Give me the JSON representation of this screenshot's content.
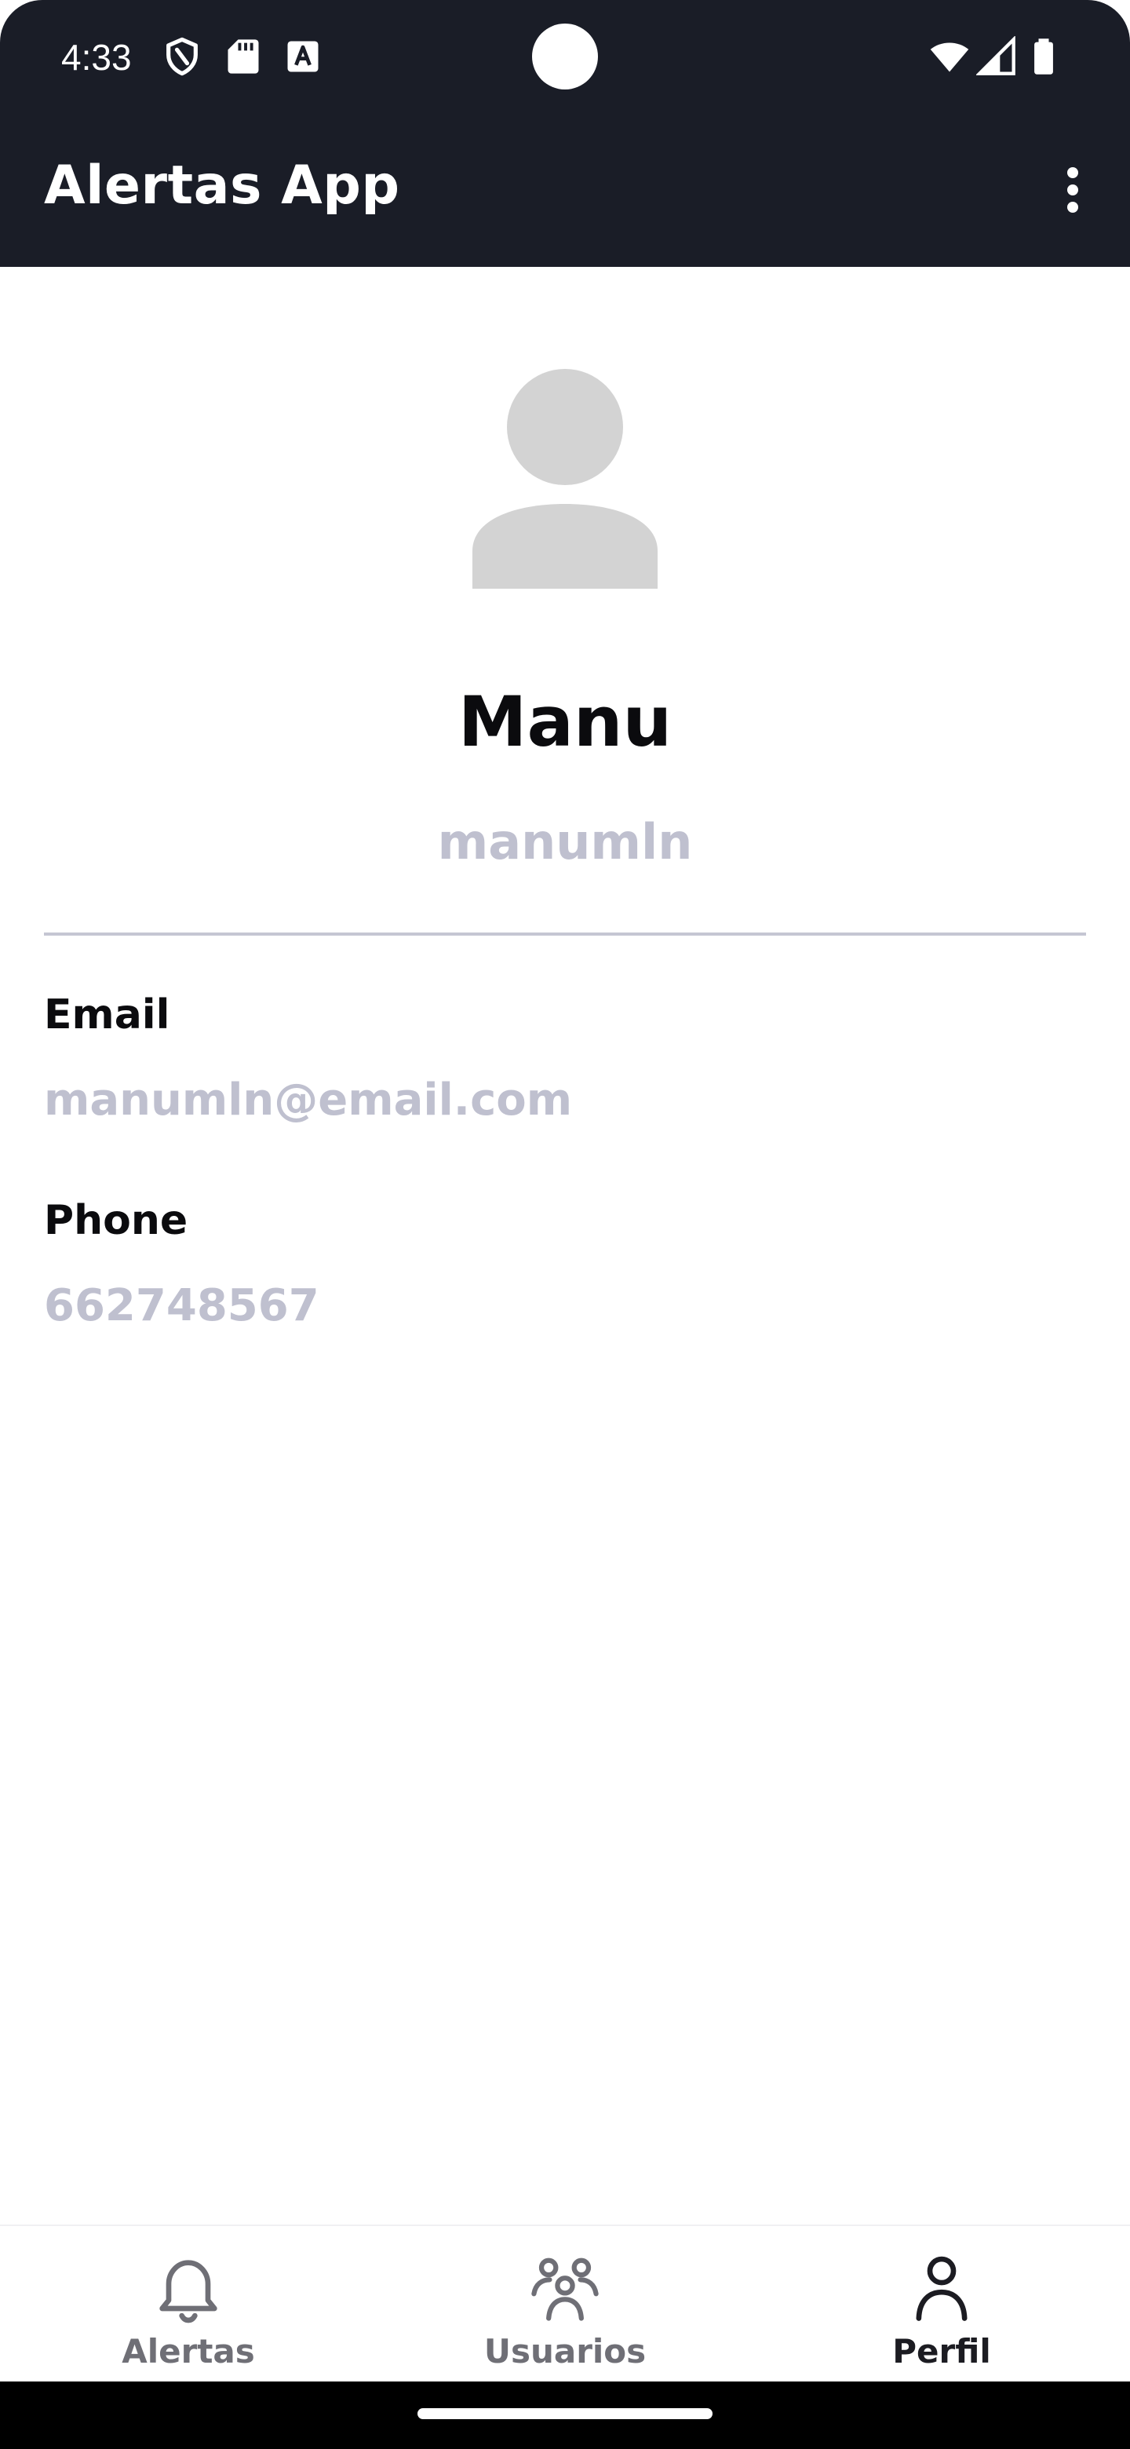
{
  "status_bar": {
    "time": "4:33",
    "icons": [
      "shield-icon",
      "sd-card-icon",
      "accessibility-a-icon",
      "wifi-icon",
      "cell-signal-icon",
      "battery-icon"
    ]
  },
  "app_bar": {
    "title": "Alertas App",
    "overflow_icon": "more-vert-icon"
  },
  "profile": {
    "avatar_icon": "person-avatar-icon",
    "name": "Manu",
    "username": "manumln",
    "fields": [
      {
        "label": "Email",
        "value": "manumln@email.com"
      },
      {
        "label": "Phone",
        "value": "662748567"
      }
    ]
  },
  "bottom_nav": {
    "items": [
      {
        "label": "Alertas",
        "icon": "bell-icon",
        "active": false
      },
      {
        "label": "Usuarios",
        "icon": "users-group-icon",
        "active": false
      },
      {
        "label": "Perfil",
        "icon": "user-icon",
        "active": true
      }
    ]
  },
  "colors": {
    "app_bar_bg": "#1a1d27",
    "secondary_text": "#bfc0cf",
    "primary_text": "#0b0b0e",
    "divider": "#c5c6d3",
    "nav_inactive": "#6f6f76",
    "nav_active": "#1c1c22",
    "avatar": "#d3d3d3"
  }
}
